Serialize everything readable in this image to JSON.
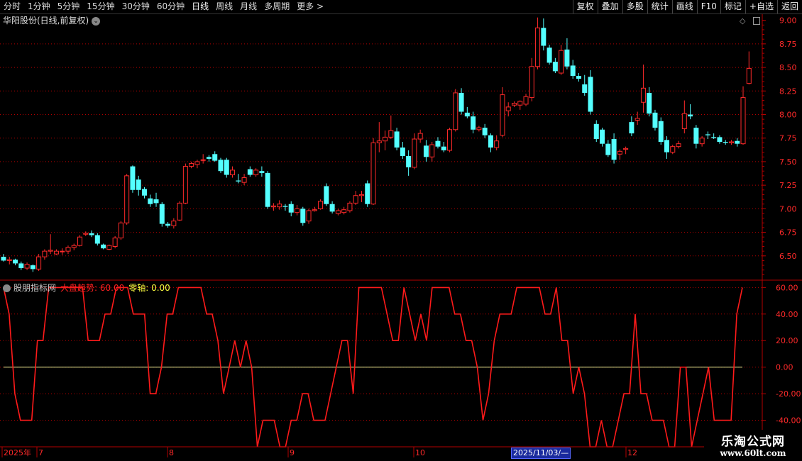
{
  "toolbar": {
    "tabs": [
      "分时",
      "1分钟",
      "5分钟",
      "15分钟",
      "30分钟",
      "60分钟",
      "日线",
      "周线",
      "月线",
      "多周期",
      "更多 >"
    ],
    "active_tab": "日线",
    "buttons": [
      "复权",
      "叠加",
      "多股",
      "统计",
      "画线",
      "F10",
      "标记",
      "+自选",
      "返回"
    ]
  },
  "stock": {
    "title": "华阳股份(日线,前复权)"
  },
  "indicator": {
    "name": "股朋指标网",
    "series1": "大盘趋势: 60.00",
    "series2": "零轴: 0.00"
  },
  "colors": {
    "up": "#ff2a2a",
    "down": "#54ffff",
    "axis": "#b40000",
    "series": "#ff1a1a",
    "zero": "#ffffa0"
  },
  "chart_data": [
    {
      "type": "candlestick",
      "y_ticks": [
        "9.00",
        "8.75",
        "8.50",
        "8.25",
        "8.00",
        "7.75",
        "7.50",
        "7.25",
        "7.00",
        "6.75",
        "6.50"
      ],
      "ylim": [
        6.25,
        9.05
      ],
      "ohlc": [
        [
          6.49,
          6.52,
          6.44,
          6.45
        ],
        [
          6.45,
          6.49,
          6.41,
          6.46
        ],
        [
          6.46,
          6.47,
          6.4,
          6.42
        ],
        [
          6.42,
          6.44,
          6.35,
          6.37
        ],
        [
          6.37,
          6.43,
          6.35,
          6.41
        ],
        [
          6.4,
          6.41,
          6.33,
          6.36
        ],
        [
          6.36,
          6.52,
          6.34,
          6.49
        ],
        [
          6.49,
          6.57,
          6.46,
          6.55
        ],
        [
          6.55,
          6.73,
          6.52,
          6.56
        ],
        [
          6.52,
          6.57,
          6.51,
          6.55
        ],
        [
          6.55,
          6.58,
          6.51,
          6.55
        ],
        [
          6.55,
          6.61,
          6.52,
          6.59
        ],
        [
          6.59,
          6.63,
          6.56,
          6.61
        ],
        [
          6.61,
          6.72,
          6.6,
          6.7
        ],
        [
          6.73,
          6.76,
          6.71,
          6.74
        ],
        [
          6.74,
          6.77,
          6.7,
          6.72
        ],
        [
          6.72,
          6.74,
          6.61,
          6.63
        ],
        [
          6.62,
          6.63,
          6.57,
          6.58
        ],
        [
          6.57,
          6.62,
          6.56,
          6.61
        ],
        [
          6.6,
          6.71,
          6.58,
          6.69
        ],
        [
          6.69,
          6.87,
          6.67,
          6.85
        ],
        [
          6.85,
          7.37,
          6.83,
          7.35
        ],
        [
          7.45,
          7.46,
          7.17,
          7.2
        ],
        [
          7.31,
          7.35,
          7.14,
          7.2
        ],
        [
          7.21,
          7.23,
          7.11,
          7.14
        ],
        [
          7.11,
          7.15,
          7.02,
          7.05
        ],
        [
          7.1,
          7.17,
          7.02,
          7.06
        ],
        [
          7.05,
          7.07,
          6.81,
          6.84
        ],
        [
          6.84,
          6.86,
          6.8,
          6.82
        ],
        [
          6.82,
          6.9,
          6.79,
          6.87
        ],
        [
          6.88,
          7.08,
          6.87,
          7.06
        ],
        [
          7.06,
          7.48,
          7.05,
          7.45
        ],
        [
          7.45,
          7.5,
          7.43,
          7.48
        ],
        [
          7.47,
          7.52,
          7.43,
          7.5
        ],
        [
          7.52,
          7.58,
          7.48,
          7.52
        ],
        [
          7.55,
          7.57,
          7.5,
          7.53
        ],
        [
          7.58,
          7.61,
          7.5,
          7.51
        ],
        [
          7.52,
          7.54,
          7.38,
          7.4
        ],
        [
          7.52,
          7.54,
          7.33,
          7.36
        ],
        [
          7.36,
          7.45,
          7.33,
          7.41
        ],
        [
          7.3,
          7.37,
          7.27,
          7.29
        ],
        [
          7.28,
          7.37,
          7.25,
          7.33
        ],
        [
          7.42,
          7.45,
          7.34,
          7.36
        ],
        [
          7.36,
          7.43,
          7.34,
          7.41
        ],
        [
          7.4,
          7.45,
          7.34,
          7.38
        ],
        [
          7.38,
          7.4,
          7.0,
          7.02
        ],
        [
          7.02,
          7.06,
          6.98,
          7.03
        ],
        [
          7.02,
          7.09,
          6.99,
          7.05
        ],
        [
          7.03,
          7.05,
          6.98,
          7.02
        ],
        [
          7.05,
          7.08,
          6.92,
          6.96
        ],
        [
          6.96,
          7.04,
          6.93,
          7.0
        ],
        [
          7.0,
          7.02,
          6.82,
          6.85
        ],
        [
          6.87,
          7.0,
          6.84,
          6.98
        ],
        [
          6.98,
          7.02,
          6.97,
          6.99
        ],
        [
          7.0,
          7.1,
          6.99,
          7.08
        ],
        [
          7.24,
          7.27,
          7.03,
          7.05
        ],
        [
          7.05,
          7.08,
          6.95,
          6.97
        ],
        [
          6.95,
          7.0,
          6.93,
          6.98
        ],
        [
          6.96,
          7.02,
          6.94,
          6.99
        ],
        [
          6.98,
          7.08,
          6.96,
          7.06
        ],
        [
          7.06,
          7.19,
          7.04,
          7.14
        ],
        [
          7.14,
          7.19,
          7.07,
          7.15
        ],
        [
          7.27,
          7.3,
          7.02,
          7.05
        ],
        [
          7.05,
          7.75,
          7.04,
          7.7
        ],
        [
          7.7,
          7.92,
          7.6,
          7.72
        ],
        [
          7.72,
          7.83,
          7.62,
          7.76
        ],
        [
          7.76,
          7.99,
          7.74,
          7.83
        ],
        [
          7.82,
          7.86,
          7.62,
          7.65
        ],
        [
          7.65,
          7.71,
          7.53,
          7.56
        ],
        [
          7.56,
          7.62,
          7.35,
          7.44
        ],
        [
          7.44,
          7.8,
          7.42,
          7.74
        ],
        [
          7.74,
          7.84,
          7.7,
          7.8
        ],
        [
          7.67,
          7.73,
          7.5,
          7.55
        ],
        [
          7.55,
          7.71,
          7.5,
          7.68
        ],
        [
          7.72,
          7.76,
          7.64,
          7.66
        ],
        [
          7.66,
          7.71,
          7.6,
          7.62
        ],
        [
          7.62,
          7.86,
          7.6,
          7.84
        ],
        [
          7.84,
          8.27,
          7.82,
          8.23
        ],
        [
          8.23,
          8.28,
          8.0,
          8.03
        ],
        [
          8.02,
          8.08,
          7.96,
          7.98
        ],
        [
          7.98,
          8.03,
          7.8,
          7.84
        ],
        [
          7.84,
          7.88,
          7.82,
          7.86
        ],
        [
          7.86,
          7.9,
          7.75,
          7.78
        ],
        [
          7.78,
          7.8,
          7.6,
          7.65
        ],
        [
          7.65,
          7.78,
          7.62,
          7.72
        ],
        [
          7.78,
          8.29,
          7.76,
          8.21
        ],
        [
          8.04,
          8.13,
          7.98,
          8.08
        ],
        [
          8.1,
          8.14,
          8.08,
          8.12
        ],
        [
          8.1,
          8.15,
          8.05,
          8.14
        ],
        [
          8.11,
          8.22,
          8.09,
          8.19
        ],
        [
          8.18,
          8.6,
          8.14,
          8.51
        ],
        [
          8.51,
          9.03,
          8.48,
          8.92
        ],
        [
          8.92,
          9.02,
          8.68,
          8.73
        ],
        [
          8.71,
          8.74,
          8.53,
          8.55
        ],
        [
          8.56,
          8.6,
          8.44,
          8.46
        ],
        [
          8.44,
          8.74,
          8.42,
          8.68
        ],
        [
          8.69,
          8.81,
          8.48,
          8.51
        ],
        [
          8.52,
          8.58,
          8.38,
          8.41
        ],
        [
          8.41,
          8.44,
          8.35,
          8.38
        ],
        [
          8.32,
          8.42,
          8.2,
          8.23
        ],
        [
          8.4,
          8.47,
          8.0,
          8.03
        ],
        [
          7.9,
          7.94,
          7.71,
          7.74
        ],
        [
          7.84,
          7.86,
          7.66,
          7.69
        ],
        [
          7.69,
          7.73,
          7.55,
          7.57
        ],
        [
          7.74,
          7.8,
          7.48,
          7.52
        ],
        [
          7.58,
          7.63,
          7.52,
          7.61
        ],
        [
          7.63,
          7.66,
          7.58,
          7.64
        ],
        [
          7.92,
          7.98,
          7.77,
          7.8
        ],
        [
          7.94,
          8.03,
          7.89,
          7.96
        ],
        [
          8.13,
          8.53,
          8.02,
          8.28
        ],
        [
          8.23,
          8.29,
          7.98,
          8.01
        ],
        [
          8.02,
          8.05,
          7.83,
          7.86
        ],
        [
          7.93,
          7.97,
          7.68,
          7.71
        ],
        [
          7.73,
          7.77,
          7.53,
          7.6
        ],
        [
          7.6,
          7.68,
          7.58,
          7.66
        ],
        [
          7.66,
          7.72,
          7.64,
          7.69
        ],
        [
          7.85,
          8.15,
          7.8,
          8.01
        ],
        [
          8.0,
          8.11,
          7.95,
          7.98
        ],
        [
          7.86,
          7.89,
          7.64,
          7.69
        ],
        [
          7.69,
          7.77,
          7.66,
          7.75
        ],
        [
          7.79,
          7.82,
          7.74,
          7.78
        ],
        [
          7.76,
          7.8,
          7.74,
          7.75
        ],
        [
          7.76,
          7.78,
          7.69,
          7.71
        ],
        [
          7.71,
          7.73,
          7.68,
          7.7
        ],
        [
          7.7,
          7.73,
          7.68,
          7.71
        ],
        [
          7.72,
          7.75,
          7.66,
          7.69
        ],
        [
          7.69,
          8.3,
          7.68,
          8.18
        ],
        [
          8.33,
          8.67,
          8.32,
          8.49
        ]
      ],
      "x_labels": [
        "2025年",
        "7",
        "8",
        "9",
        "10",
        "2025/11/03/—",
        "12"
      ]
    },
    {
      "type": "line",
      "name": "大盘趋势",
      "y_ticks": [
        "60.00",
        "40.00",
        "20.00",
        "0.00",
        "-20.00",
        "-40.00"
      ],
      "ylim": [
        -60,
        65
      ],
      "values": [
        60,
        40,
        -20,
        -40,
        -40,
        -40,
        20,
        20,
        60,
        60,
        60,
        60,
        60,
        60,
        60,
        20,
        20,
        20,
        40,
        40,
        60,
        60,
        60,
        40,
        40,
        40,
        -20,
        -20,
        0,
        40,
        40,
        60,
        60,
        60,
        60,
        60,
        40,
        40,
        20,
        -20,
        0,
        20,
        0,
        20,
        0,
        -60,
        -40,
        -40,
        -40,
        -60,
        -60,
        -40,
        -40,
        -20,
        -20,
        -40,
        -40,
        -40,
        -20,
        0,
        20,
        20,
        -20,
        60,
        60,
        60,
        60,
        60,
        40,
        20,
        20,
        60,
        40,
        20,
        40,
        20,
        60,
        60,
        60,
        60,
        40,
        40,
        20,
        20,
        0,
        -40,
        -20,
        20,
        40,
        40,
        40,
        60,
        60,
        60,
        60,
        60,
        40,
        40,
        60,
        20,
        20,
        -20,
        0,
        -20,
        -60,
        -60,
        -40,
        -60,
        -60,
        -40,
        -20,
        -20,
        40,
        -20,
        -20,
        -40,
        -40,
        -40,
        -60,
        -60,
        0,
        0,
        -60,
        -40,
        -20,
        0,
        -40,
        -40,
        -40,
        -40,
        40,
        60
      ],
      "zero_line": 0
    }
  ]
}
